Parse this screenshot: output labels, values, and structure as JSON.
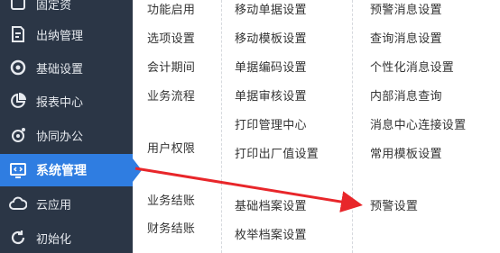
{
  "sidebar": {
    "items": [
      {
        "label": "固定资",
        "icon": "box-icon"
      },
      {
        "label": "出纳管理",
        "icon": "cashier-icon"
      },
      {
        "label": "基础设置",
        "icon": "gear-icon"
      },
      {
        "label": "报表中心",
        "icon": "pie-chart-icon"
      },
      {
        "label": "协同办公",
        "icon": "collab-icon"
      },
      {
        "label": "系统管理",
        "icon": "code-monitor-icon",
        "active": true
      },
      {
        "label": "云应用",
        "icon": "cloud-icon"
      },
      {
        "label": "初始化",
        "icon": "refresh-icon"
      }
    ]
  },
  "menu": {
    "col1": [
      "功能启用",
      "选项设置",
      "会计期间",
      "业务流程",
      "用户权限",
      "业务结账",
      "财务结账"
    ],
    "col2": [
      "移动单据设置",
      "移动模板设置",
      "单据编码设置",
      "单据审核设置",
      "打印管理中心",
      "打印出厂值设置",
      "基础档案设置",
      "枚举档案设置"
    ],
    "col3": [
      "预警消息设置",
      "查询消息设置",
      "个性化消息设置",
      "内部消息查询",
      "消息中心连接设置",
      "常用模板设置",
      "预警设置"
    ]
  },
  "colors": {
    "sidebar_bg": "#2b3646",
    "active_bg": "#2f7de1",
    "annotation_arrow": "#e8262a"
  }
}
